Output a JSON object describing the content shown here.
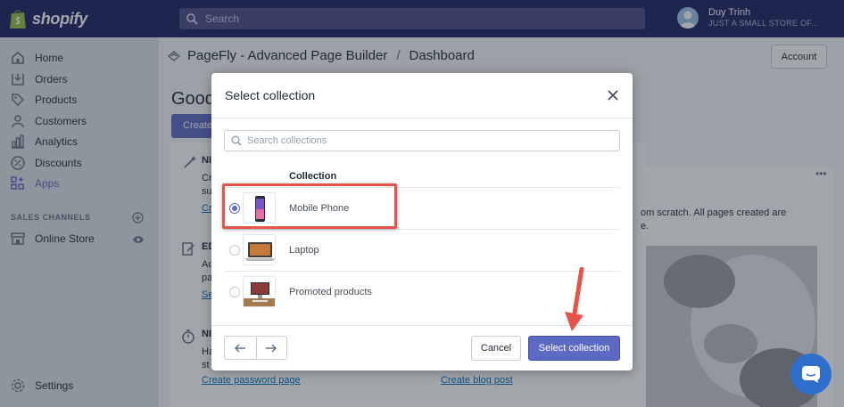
{
  "topbar": {
    "logo_text": "shopify",
    "search_placeholder": "Search",
    "user_name": "Duy Trinh",
    "user_store": "JUST A SMALL STORE OF..."
  },
  "sidebar": {
    "items": [
      {
        "label": "Home",
        "icon": "home-icon"
      },
      {
        "label": "Orders",
        "icon": "orders-icon"
      },
      {
        "label": "Products",
        "icon": "tag-icon"
      },
      {
        "label": "Customers",
        "icon": "customers-icon"
      },
      {
        "label": "Analytics",
        "icon": "analytics-icon"
      },
      {
        "label": "Discounts",
        "icon": "discount-icon"
      },
      {
        "label": "Apps",
        "icon": "apps-icon"
      }
    ],
    "sales_channels_title": "SALES CHANNELS",
    "online_store_label": "Online Store",
    "settings_label": "Settings"
  },
  "page": {
    "app_name": "PageFly - Advanced Page Builder",
    "separator": "/",
    "page_name": "Dashboard",
    "account_label": "Account",
    "greeting": "Good",
    "create_label": "Create",
    "card_frags": {
      "head1": "NI",
      "t1a": "Cr",
      "t1b": "su",
      "l1": "Cr",
      "head2": "ED",
      "t2a": "Ac",
      "t2b": "pa",
      "l2": "Se",
      "head3": "NI",
      "t3a": "Ha",
      "t3b": "st"
    },
    "password_link": "Create password page",
    "blog_link": "Create blog post",
    "right_text_1": "om scratch. All pages created are",
    "right_text_2": "e.",
    "dots": "•••"
  },
  "modal": {
    "title": "Select collection",
    "search_placeholder": "Search collections",
    "column_header": "Collection",
    "rows": [
      {
        "label": "Mobile Phone",
        "selected": true
      },
      {
        "label": "Laptop",
        "selected": false
      },
      {
        "label": "Promoted products",
        "selected": false
      }
    ],
    "cancel_label": "Cancel",
    "select_label": "Select collection"
  },
  "colors": {
    "topbar": "#1c2260",
    "primary": "#5c6ac4",
    "annotation": "#e5534b",
    "chat": "#2f6ecb"
  }
}
